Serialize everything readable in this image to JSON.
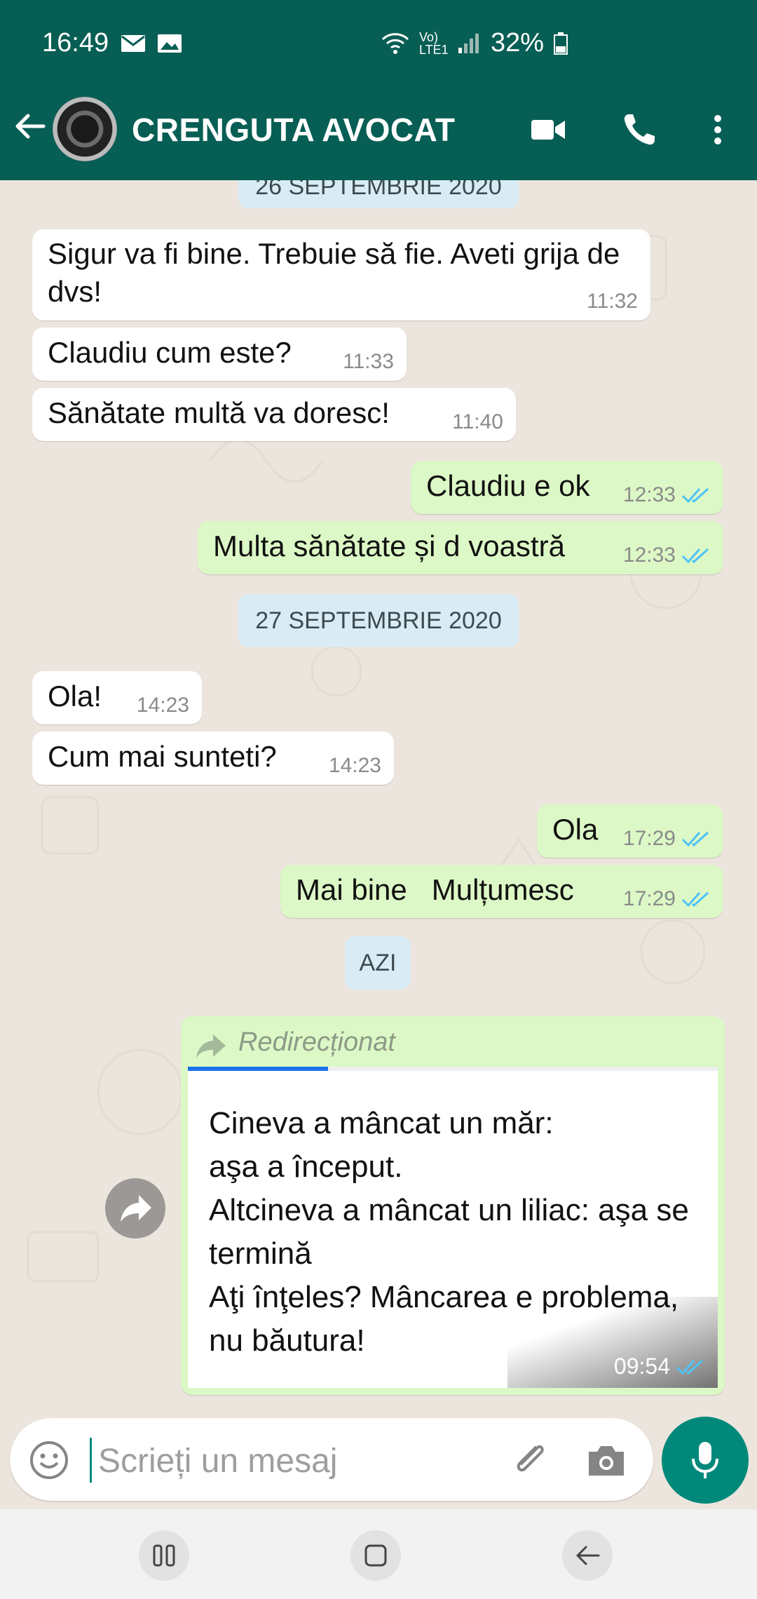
{
  "status_bar": {
    "time": "16:49",
    "network": "Vo) LTE1",
    "battery": "32%"
  },
  "header": {
    "contact_name": "CRENGUTA AVOCAT",
    "icons": [
      "back-arrow-icon",
      "avatar",
      "video-call-icon",
      "phone-icon",
      "more-vert-icon"
    ]
  },
  "chat": {
    "date_top_partial": "26 SEPTEMBRIE 2020",
    "messages_1": [
      {
        "dir": "in",
        "text": "Sigur va fi bine. Trebuie să fie. Aveti grija de dvs!",
        "time": "11:32"
      },
      {
        "dir": "in",
        "text": "Claudiu cum este?",
        "time": "11:33"
      },
      {
        "dir": "in",
        "text": "Sănătate multă va doresc!",
        "time": "11:40"
      },
      {
        "dir": "out",
        "text": "Claudiu e ok",
        "time": "12:33"
      },
      {
        "dir": "out",
        "text": "Multa sănătate și d voastră",
        "time": "12:33"
      }
    ],
    "date_2": "27 SEPTEMBRIE 2020",
    "messages_2": [
      {
        "dir": "in",
        "text": "Ola!",
        "time": "14:23"
      },
      {
        "dir": "in",
        "text": "Cum mai sunteti?",
        "time": "14:23"
      },
      {
        "dir": "out",
        "text": "Ola",
        "time": "17:29"
      },
      {
        "dir": "out",
        "text": "Mai bine   Mulțumesc",
        "time": "17:29"
      }
    ],
    "date_3": "AZI",
    "forwarded": {
      "label": "Redirecționat",
      "text": "Cineva a mâncat un măr:\naşa a început.\nAltcineva a mâncat un liliac: aşa se termină\nAţi înţeles? Mâncarea e problema, nu băutura!",
      "time": "09:54"
    }
  },
  "composer": {
    "placeholder": "Scrieți un mesaj"
  },
  "colors": {
    "header": "#075e54",
    "outgoing": "#dcf8c6",
    "incoming": "#ffffff",
    "accent": "#00897b",
    "read_ticks": "#4fc3f7"
  }
}
